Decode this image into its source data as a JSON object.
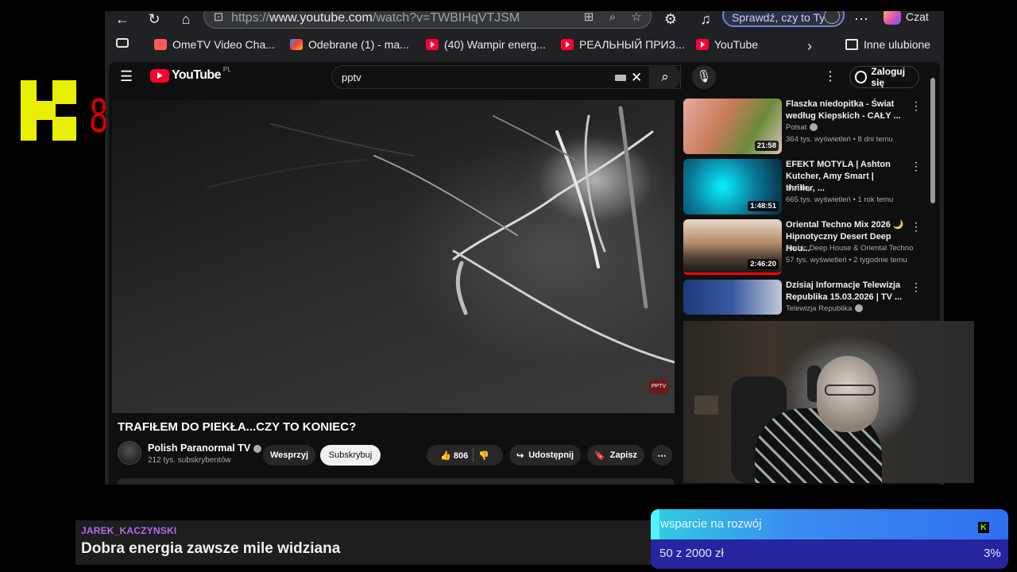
{
  "browser": {
    "url_prefix": "https://",
    "url_host": "www.youtube.com",
    "url_path": "/watch?v=TWBIHqVTJSM",
    "sprawdz_label": "Sprawdź, czy to Ty",
    "czat_label": "Czat",
    "bookmarks": [
      {
        "label": "OmeTV Video Cha...",
        "icon": "ometv-icon",
        "color": "#ff5a5a"
      },
      {
        "label": "Odebrane (1) - ma...",
        "icon": "gmail-icon",
        "color": "#ea4335"
      },
      {
        "label": "(40) Wampir energ...",
        "icon": "youtube-icon",
        "color": "#ff0033"
      },
      {
        "label": "РЕАЛЬНЫЙ ПРИЗ...",
        "icon": "youtube-icon",
        "color": "#ff0033"
      },
      {
        "label": "YouTube",
        "icon": "youtube-icon",
        "color": "#ff0033"
      }
    ],
    "other_favorites": "Inne ulubione"
  },
  "youtube": {
    "logo_text": "YouTube",
    "region": "PL",
    "search_query": "pptv",
    "login_label": "Zaloguj się",
    "video": {
      "title": "TRAFIŁEM DO PIEKŁA...CZY TO KONIEC?",
      "channel": "Polish Paranormal TV",
      "subscribers": "212 tys. subskrybentów",
      "support_label": "Wesprzyj",
      "subscribe_label": "Subskrybuj",
      "likes": "806",
      "share_label": "Udostępnij",
      "save_label": "Zapisz",
      "watermark": "PPTV"
    },
    "recommendations": [
      {
        "title": "Flaszka niedopitka - Świat według Kiepskich - CAŁY ...",
        "channel": "Polsat",
        "verified": true,
        "meta": "364 tys. wyświetleń • 8 dni temu",
        "duration": "21:58"
      },
      {
        "title": "EFEKT MOTYLA | Ashton Kutcher, Amy Smart | thriller, ...",
        "channel": "alefilmy",
        "verified": false,
        "meta": "665 tys. wyświetleń • 1 rok temu",
        "duration": "1:48:51"
      },
      {
        "title": "Oriental Techno Mix 2026 🌙 Hipnotyczny Desert Deep Hou...",
        "channel": "Arabic Deep House & Oriental Techno",
        "verified": false,
        "meta": "57 tys. wyświetleń • 2 tygodnie temu",
        "duration": "2:46:20"
      },
      {
        "title": "Dzisiaj Informacje Telewizja Republika 15.03.2026 | TV ...",
        "channel": "Telewizja Republika",
        "verified": true,
        "meta": "",
        "duration": ""
      }
    ]
  },
  "overlay": {
    "chat_user": "JAREK_KACZYNSKI",
    "chat_message": "Dobra energia zawsze mile widziana",
    "counter": "8",
    "goal_title": "wsparcie na rozwój",
    "goal_amount": "50  z  2000  zł",
    "goal_percent": "3%",
    "goal_progress": 0.025,
    "colors": {
      "logo": "#e8f000",
      "counter": "#d00000",
      "chat_user": "#b06cf0",
      "goal_bg": "#2525a0",
      "goal_bar": "#53f1ff"
    }
  }
}
